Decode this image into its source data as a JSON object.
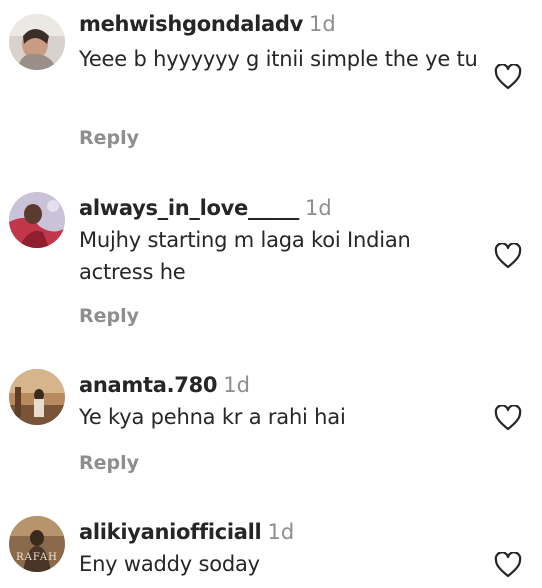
{
  "comments": [
    {
      "username": "mehwishgondaladv",
      "time": "1d",
      "text": "Yeee b hyyyyyy g itnii simple the ye tu",
      "reply": "Reply",
      "avatar_icon": "user-avatar"
    },
    {
      "username": "always_in_love_____",
      "time": "1d",
      "text": "Mujhy starting m laga koi Indian actress he",
      "reply": "Reply",
      "avatar_icon": "user-avatar"
    },
    {
      "username": "anamta.780",
      "time": "1d",
      "text": "Ye kya pehna kr a rahi hai",
      "reply": "Reply",
      "avatar_icon": "user-avatar"
    },
    {
      "username": "alikiyaniofficiall",
      "time": "1d",
      "text": "Eny waddy soday",
      "reply": "",
      "avatar_icon": "user-avatar",
      "avatar_overlay": "RAFAH"
    }
  ],
  "icons": {
    "like": "heart-outline-icon"
  },
  "colors": {
    "text": "#262626",
    "secondary": "#8e8e8e",
    "background": "#ffffff"
  }
}
